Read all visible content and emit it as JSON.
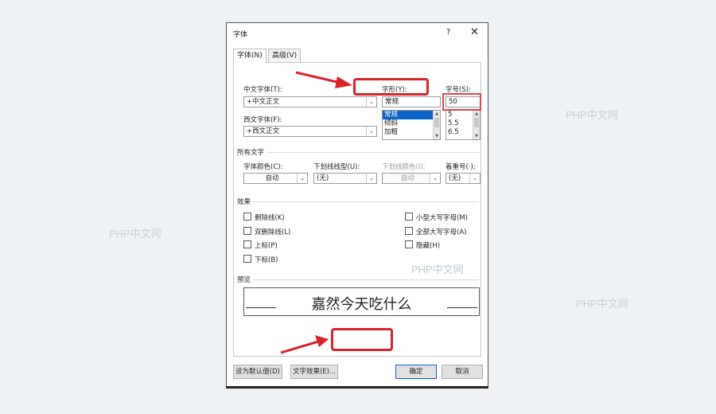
{
  "watermark": "PHP中文网",
  "dialog": {
    "title": "字体",
    "help": "?",
    "close": "✕",
    "tabs": [
      {
        "label": "字体(N)"
      },
      {
        "label": "高级(V)"
      }
    ],
    "cn_font_label": "中文字体(T):",
    "cn_font_value": "+中文正文",
    "west_font_label": "西文字体(F):",
    "west_font_value": "+西文正文",
    "style_label": "字形(Y):",
    "style_value": "常规",
    "style_options": [
      "常规",
      "倾斜",
      "加粗"
    ],
    "size_label": "字号(S):",
    "size_value": "50",
    "size_options": [
      "5",
      "5.5",
      "6.5"
    ],
    "all_text_header": "所有文字",
    "font_color_label": "字体颜色(C):",
    "font_color_value": "自动",
    "underline_type_label": "下划线线型(U):",
    "underline_type_value": "(无)",
    "underline_color_label": "下划线颜色(I):",
    "underline_color_value": "自动",
    "emphasis_label": "着重号(·);",
    "emphasis_value": "(无)",
    "effects_header": "效果",
    "effects_left": [
      "删除线(K)",
      "双删除线(L)",
      "上标(P)",
      "下标(B)"
    ],
    "effects_right": [
      "小型大写字母(M)",
      "全部大写字母(A)",
      "隐藏(H)"
    ],
    "preview_header": "预览",
    "preview_text": "嘉然今天吃什么",
    "btn_default": "设为默认值(D)",
    "btn_text_effects": "文字效果(E)...",
    "btn_ok": "确定",
    "btn_cancel": "取消"
  },
  "colors": {
    "accent": "#0a64c8",
    "annotation": "#d9232a"
  }
}
